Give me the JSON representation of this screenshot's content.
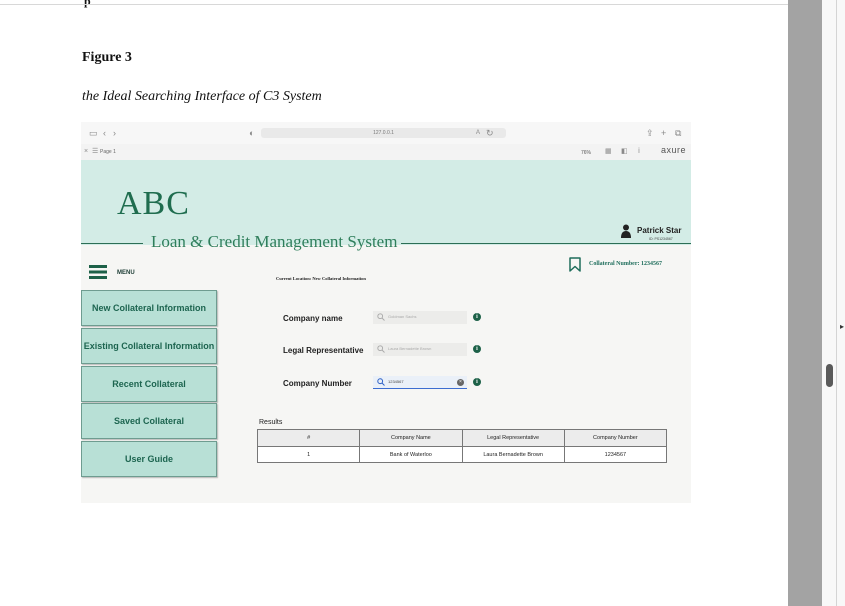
{
  "document": {
    "top_fragment": "p",
    "figure_label": "Figure 3",
    "figure_caption": "the Ideal Searching Interface of C3 System"
  },
  "browser": {
    "url": "127.0.0.1",
    "tab_title": "Page 1",
    "zoom": "76%",
    "brand": "axure",
    "icons": [
      "sidebar-icon",
      "back-icon",
      "forward-icon",
      "shield-icon",
      "translate-icon",
      "reload-icon",
      "share-icon",
      "new-tab-icon",
      "tabs-icon",
      "close-icon",
      "menu-icon",
      "grid-icon",
      "split-icon",
      "info-icon"
    ]
  },
  "app": {
    "logo": "ABC",
    "system_title": "Loan & Credit Management System",
    "user": {
      "name": "Patrick Star",
      "id": "ID: PS1234567"
    },
    "menu_label": "MENU",
    "current_location": "Current Location: New Collateral Information",
    "collateral_number": "Collateral Number: 1234567",
    "colors": {
      "banner": "#d3ece6",
      "accent": "#1f6d4f",
      "sidebar_button": "#b8e0d6"
    }
  },
  "sidebar": {
    "items": [
      {
        "label": "New Collateral Information"
      },
      {
        "label": "Existing Collateral Information"
      },
      {
        "label": "Recent Collateral"
      },
      {
        "label": "Saved Collateral"
      },
      {
        "label": "User Guide"
      }
    ]
  },
  "form": {
    "company_name": {
      "label": "Company name",
      "placeholder": "Goldman Sachs"
    },
    "legal_rep": {
      "label": "Legal Representative",
      "placeholder": "Laura Bernadette Brown"
    },
    "company_number": {
      "label": "Company Number",
      "value": "1234567"
    }
  },
  "results": {
    "label": "Results",
    "headers": [
      "#",
      "Company Name",
      "Legal Representative",
      "Company Number"
    ],
    "rows": [
      [
        "1",
        "Bank of Waterloo",
        "Laura Bernadette Brown",
        "1234567"
      ]
    ]
  }
}
